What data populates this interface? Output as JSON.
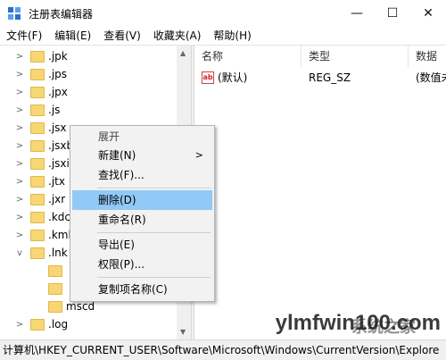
{
  "window": {
    "title": "注册表编辑器",
    "minimize_glyph": "—",
    "maximize_glyph": "☐",
    "close_glyph": "✕"
  },
  "menu": [
    "文件(F)",
    "编辑(E)",
    "查看(V)",
    "收藏夹(A)",
    "帮助(H)"
  ],
  "tree": {
    "items": [
      {
        "label": ".jpk",
        "expander": ">"
      },
      {
        "label": ".jps",
        "expander": ">"
      },
      {
        "label": ".jpx",
        "expander": ">"
      },
      {
        "label": ".js",
        "expander": ">"
      },
      {
        "label": ".jsx",
        "expander": ">"
      },
      {
        "label": ".jsxb",
        "expander": ">"
      },
      {
        "label": ".jsxi",
        "expander": ">"
      },
      {
        "label": ".jtx",
        "expander": ">"
      },
      {
        "label": ".jxr",
        "expander": ">"
      },
      {
        "label": ".kdc",
        "expander": ">"
      },
      {
        "label": ".kml",
        "expander": ">"
      },
      {
        "label": ".lnk",
        "expander": "v"
      },
      {
        "label": "",
        "expander": "",
        "child": true
      },
      {
        "label": "",
        "expander": "",
        "child": true
      },
      {
        "label": "mscd",
        "expander": "",
        "child": true
      },
      {
        "label": ".log",
        "expander": ">"
      }
    ]
  },
  "columns": {
    "name": "名称",
    "type": "类型",
    "data": "数据"
  },
  "values": [
    {
      "icon": "ab",
      "name": "(默认)",
      "type": "REG_SZ",
      "data": "(数值未"
    }
  ],
  "context_menu": {
    "items": [
      {
        "label": "展开",
        "highlighted": false
      },
      {
        "label": "新建(N)",
        "highlighted": false,
        "submenu": true
      },
      {
        "label": "查找(F)...",
        "highlighted": false
      },
      {
        "label": "删除(D)",
        "highlighted": true
      },
      {
        "label": "重命名(R)",
        "highlighted": false
      },
      {
        "label": "导出(E)",
        "highlighted": false
      },
      {
        "label": "权限(P)...",
        "highlighted": false
      },
      {
        "label": "复制项名称(C)",
        "highlighted": false
      }
    ],
    "submenu_glyph": ">"
  },
  "status_bar": "计算机\\HKEY_CURRENT_USER\\Software\\Microsoft\\Windows\\CurrentVersion\\Explore",
  "watermark": {
    "latin": "ylmfwin100.com",
    "cn": "系统之家"
  },
  "colors": {
    "highlight": "#91c9f7",
    "folder": "#f7d774"
  }
}
